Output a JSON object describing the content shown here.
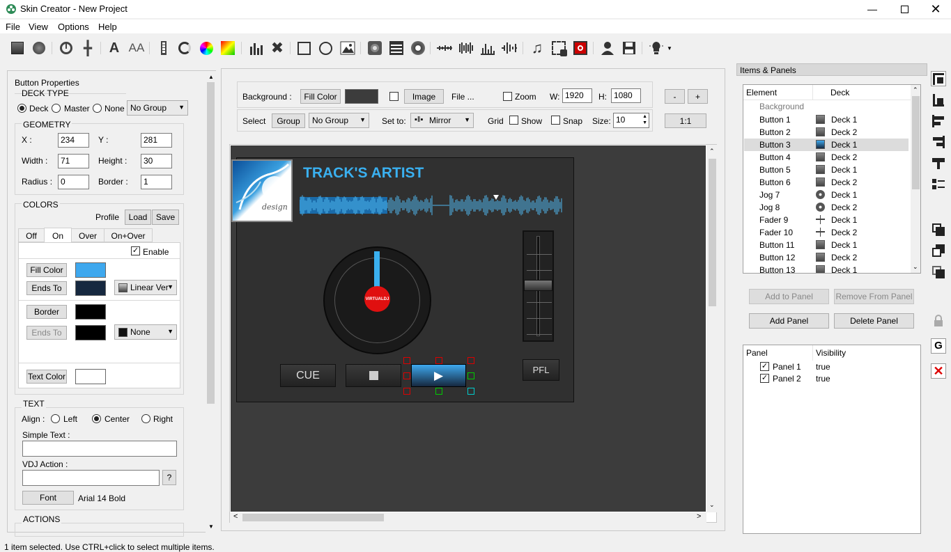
{
  "app": {
    "title": "Skin Creator - New Project"
  },
  "menu": [
    "File",
    "View",
    "Options",
    "Help"
  ],
  "toolbar_icons": [
    "button-icon",
    "jog-icon",
    "knob-icon",
    "fader-icon",
    "text-icon",
    "text-style-icon",
    "slider-icon",
    "ring-icon",
    "color-wheel-icon",
    "gradient-icon",
    "bars-icon",
    "cross-icon",
    "rect-icon",
    "circle-icon",
    "image-icon",
    "disc-icon",
    "video-icon",
    "turntable-icon",
    "wave-small-icon",
    "wave-full-icon",
    "spectrum-icon",
    "wave-pulse-icon",
    "note-icon",
    "select-image-icon",
    "rec-icon",
    "user-icon",
    "save-icon",
    "bulb-icon"
  ],
  "props": {
    "header": "Button Properties",
    "deck_type": {
      "label": "DECK TYPE",
      "options": [
        "Deck",
        "Master",
        "None"
      ],
      "selected": "Deck",
      "group": "No Group"
    },
    "geometry": {
      "label": "GEOMETRY",
      "x_label": "X :",
      "x": "234",
      "y_label": "Y :",
      "y": "281",
      "width_label": "Width :",
      "width": "71",
      "height_label": "Height :",
      "height": "30",
      "radius_label": "Radius :",
      "radius": "0",
      "border_label": "Border :",
      "border": "1"
    },
    "colors": {
      "label": "COLORS",
      "profile": "Profile",
      "load": "Load",
      "save": "Save",
      "tabs": [
        "Off",
        "On",
        "Over",
        "On+Over"
      ],
      "active_tab": "On",
      "enable": "Enable",
      "fill_color": "Fill Color",
      "fill_hex": "#3ea8ee",
      "ends_to": "Ends To",
      "ends_hex": "#16283f",
      "gradient": "Linear Ver",
      "border": "Border",
      "border_hex": "#000000",
      "ends_to2": "Ends To",
      "ends2_hex": "#000000",
      "border_mode": "None",
      "text_color": "Text Color",
      "text_hex": "#ffffff"
    },
    "text": {
      "label": "TEXT",
      "align_label": "Align :",
      "align_options": [
        "Left",
        "Center",
        "Right"
      ],
      "align_selected": "Center",
      "simple_text_label": "Simple Text :",
      "simple_text": "",
      "vdj_action_label": "VDJ Action :",
      "vdj_action": "",
      "help": "?",
      "font_button": "Font",
      "font_value": "Arial 14 Bold"
    },
    "actions": {
      "label": "ACTIONS"
    }
  },
  "canvas_controls": {
    "background_label": "Background :",
    "fill_color": "Fill Color",
    "image": "Image",
    "file": "File ...",
    "zoom": "Zoom",
    "w_label": "W:",
    "w": "1920",
    "h_label": "H:",
    "h": "1080",
    "minus": "-",
    "plus": "+",
    "one_to_one": "1:1",
    "select_label": "Select",
    "group": "Group",
    "group_value": "No Group",
    "set_to_label": "Set to:",
    "set_to_value": "Mirror",
    "grid_label": "Grid",
    "show": "Show",
    "snap": "Snap",
    "size_label": "Size:",
    "size": "10"
  },
  "skin": {
    "artist": "TRACK'S ARTIST",
    "cue": "CUE",
    "pfl": "PFL",
    "jog_logo": "VIRTUALDJ",
    "album_text": "design"
  },
  "items_panels": {
    "title": "Items & Panels",
    "columns": [
      "Element",
      "Deck"
    ],
    "background_row": "Background",
    "rows": [
      {
        "element": "Button 1",
        "deck": "Deck 1",
        "icon": "button-icon"
      },
      {
        "element": "Button 2",
        "deck": "Deck 2",
        "icon": "button-icon"
      },
      {
        "element": "Button 3",
        "deck": "Deck 1",
        "icon": "button-icon"
      },
      {
        "element": "Button 4",
        "deck": "Deck 2",
        "icon": "button-icon"
      },
      {
        "element": "Button 5",
        "deck": "Deck 1",
        "icon": "button-icon"
      },
      {
        "element": "Button 6",
        "deck": "Deck 2",
        "icon": "button-icon"
      },
      {
        "element": "Jog 7",
        "deck": "Deck 1",
        "icon": "jog-icon"
      },
      {
        "element": "Jog 8",
        "deck": "Deck 2",
        "icon": "jog-icon"
      },
      {
        "element": "Fader 9",
        "deck": "Deck 1",
        "icon": "fader-icon"
      },
      {
        "element": "Fader 10",
        "deck": "Deck 2",
        "icon": "fader-icon"
      },
      {
        "element": "Button 11",
        "deck": "Deck 1",
        "icon": "button-icon"
      },
      {
        "element": "Button 12",
        "deck": "Deck 2",
        "icon": "button-icon"
      },
      {
        "element": "Button 13",
        "deck": "Deck 1",
        "icon": "button-icon"
      }
    ],
    "selected_row": "Button 3",
    "add_to_panel": "Add to Panel",
    "remove_from_panel": "Remove From Panel",
    "add_panel": "Add Panel",
    "delete_panel": "Delete Panel",
    "panel_columns": [
      "Panel",
      "Visibility"
    ],
    "panels": [
      {
        "name": "Panel 1",
        "visibility": "true"
      },
      {
        "name": "Panel 2",
        "visibility": "true"
      }
    ]
  },
  "status": "1 item selected. Use CTRL+click to select multiple items."
}
